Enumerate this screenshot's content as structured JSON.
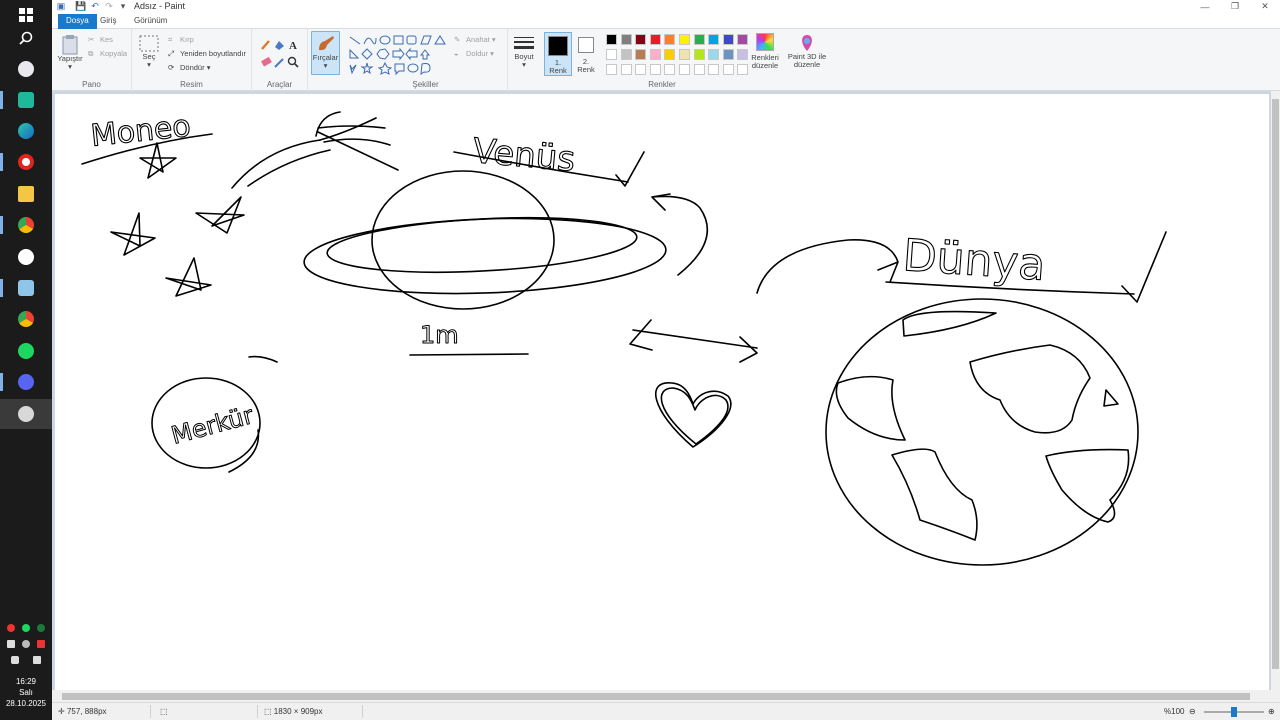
{
  "window": {
    "title": "Adsız - Paint"
  },
  "tabs": [
    {
      "label": "Dosya"
    },
    {
      "label": "Giriş"
    },
    {
      "label": "Görünüm"
    }
  ],
  "ribbon": {
    "pano": {
      "label": "Pano",
      "paste": "Yapıştır",
      "cut": "Kes",
      "copy": "Kopyala"
    },
    "resim": {
      "label": "Resim",
      "select": "Seç",
      "crop": "Kırp",
      "resize": "Yeniden boyutlandır",
      "rotate": "Döndür"
    },
    "araclar": {
      "label": "Araçlar"
    },
    "fircalar": {
      "label": "Fırçalar"
    },
    "sekiller": {
      "label": "Şekiller",
      "outline": "Anahat",
      "fill": "Doldur"
    },
    "boyut": {
      "label": "Boyut"
    },
    "renk1": {
      "label1": "1.",
      "label2": "Renk"
    },
    "renk2": {
      "label1": "2.",
      "label2": "Renk"
    },
    "renkler": {
      "label": "Renkler",
      "edit1": "Renkleri",
      "edit2": "düzenle"
    },
    "paint3d": {
      "label1": "Paint 3D ile",
      "label2": "düzenle"
    }
  },
  "palette": {
    "row1": [
      "#000000",
      "#7f7f7f",
      "#880015",
      "#ed1c24",
      "#ff7f27",
      "#fff200",
      "#22b14c",
      "#00a2e8",
      "#3f48cc",
      "#a349a4"
    ],
    "row2": [
      "#ffffff",
      "#c3c3c3",
      "#b97a57",
      "#ffaec9",
      "#ffc90e",
      "#efe4b0",
      "#b5e61d",
      "#99d9ea",
      "#7092be",
      "#c8bfe7"
    ]
  },
  "colors": {
    "primary": "#000000",
    "secondary": "#ffffff",
    "accent": "#1979ca"
  },
  "drawing": {
    "labels": {
      "moneo": "Moneo",
      "venus": "Venüs",
      "dunya": "Dünya",
      "merkur": "Merkür",
      "one_m": "1m"
    }
  },
  "status": {
    "cursor_pos": "757, 888px",
    "canvas_size": "1830 × 909px",
    "zoom": "%100"
  },
  "taskbar": {
    "apps": [
      "windows-start",
      "search",
      "paint-app",
      "media-app",
      "edge",
      "opera",
      "file-explorer",
      "chrome",
      "steam",
      "notes-app",
      "chrome-profile",
      "spotify",
      "discord",
      "paint-active"
    ]
  },
  "clock": {
    "time": "16:29",
    "day": "Salı",
    "date": "28.10.2025"
  }
}
